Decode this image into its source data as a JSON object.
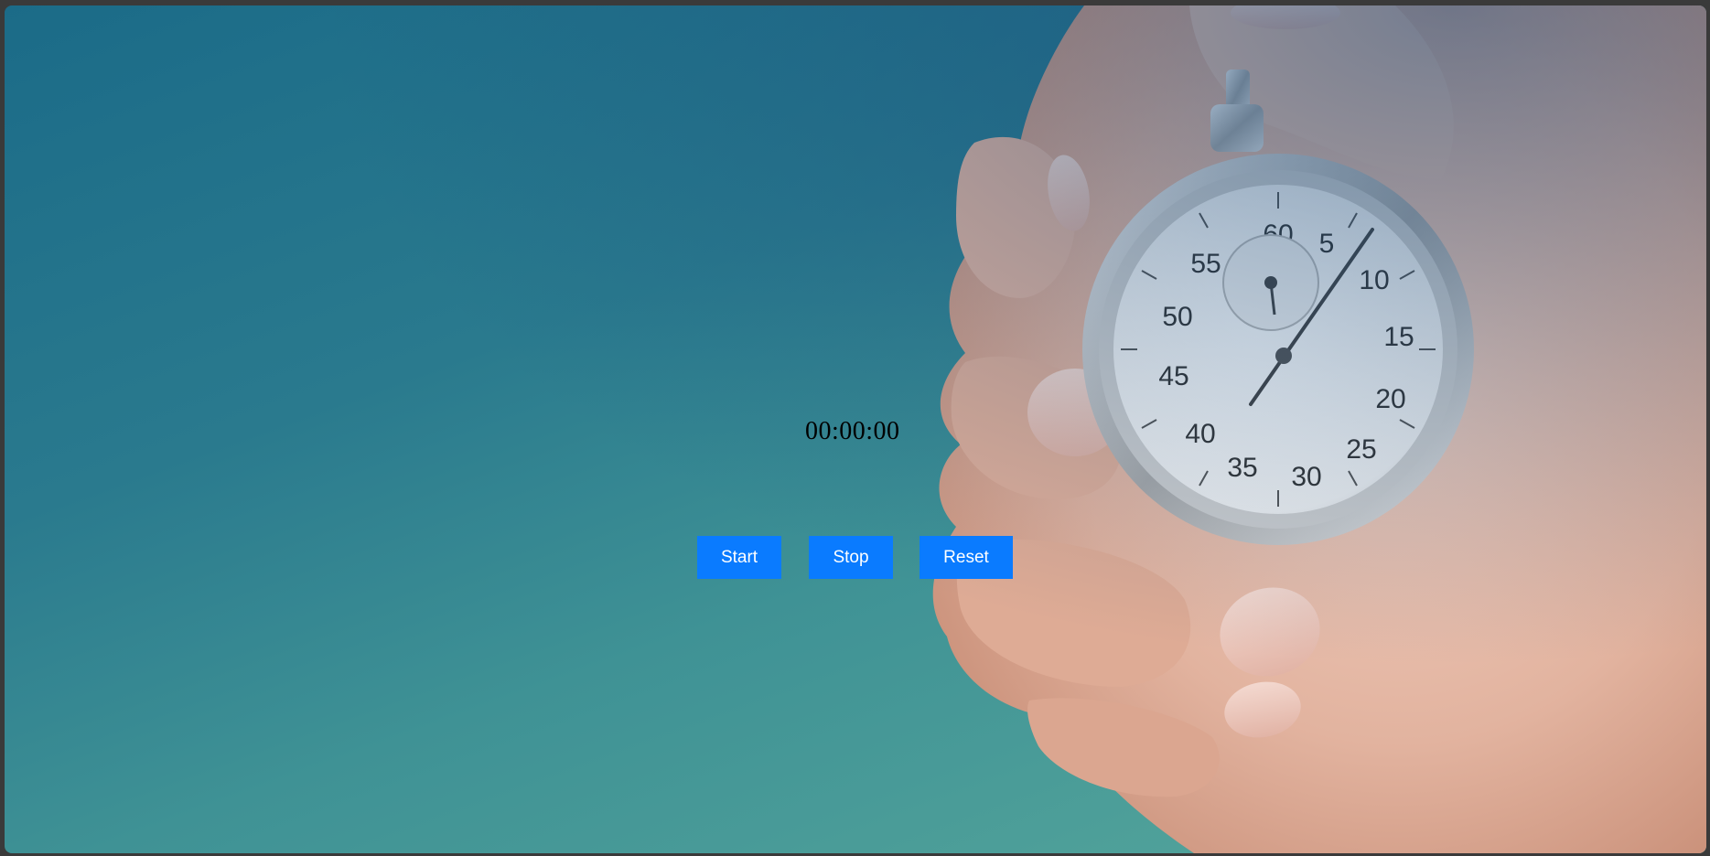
{
  "timer": {
    "display": "00:00:00"
  },
  "controls": {
    "start_label": "Start",
    "stop_label": "Stop",
    "reset_label": "Reset"
  },
  "colors": {
    "button_bg": "#0a7bff",
    "button_text": "#ffffff",
    "timer_text": "#000000",
    "background_top": "#1b6b88",
    "background_bottom": "#57a89c"
  },
  "background": {
    "icon": "hand-holding-stopwatch",
    "dial_numbers": [
      "60",
      "5",
      "10",
      "15",
      "20",
      "25",
      "30",
      "35",
      "40",
      "45",
      "50",
      "55"
    ]
  }
}
